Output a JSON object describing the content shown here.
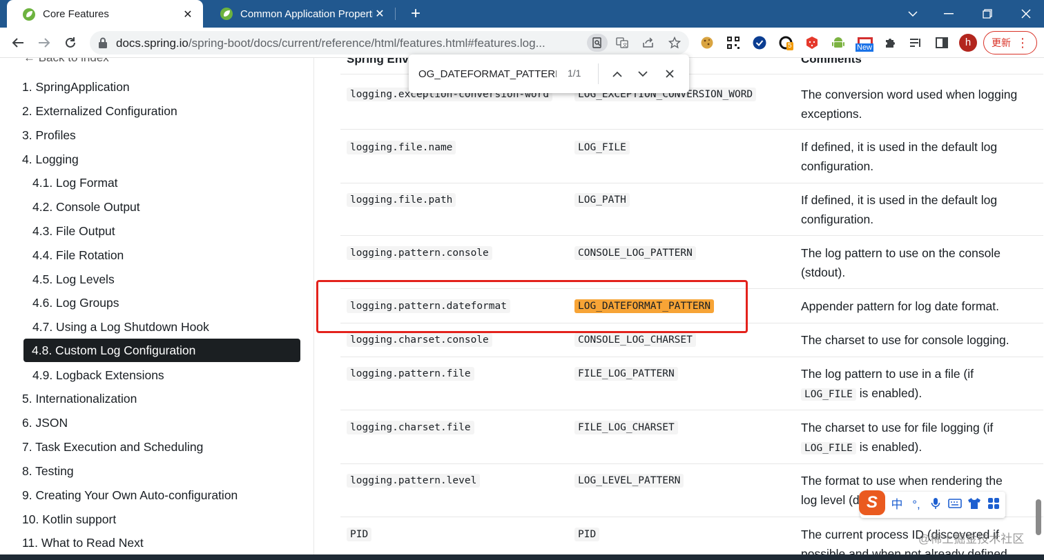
{
  "tabs": [
    {
      "title": "Core Features",
      "active": true
    },
    {
      "title": "Common Application Properties",
      "active": false
    }
  ],
  "address": {
    "host": "docs.spring.io",
    "path": "/spring-boot/docs/current/reference/html/features.html#features.log..."
  },
  "toolbar": {
    "profile_initial": "h",
    "update_label": "更新",
    "new_badge": "New",
    "ext_badge": "5"
  },
  "find": {
    "query": "OG_DATEFORMAT_PATTERN",
    "count": "1/1"
  },
  "sidebar": {
    "back": "← Back to index",
    "items": [
      {
        "label": "1. SpringApplication"
      },
      {
        "label": "2. Externalized Configuration"
      },
      {
        "label": "3. Profiles"
      },
      {
        "label": "4. Logging"
      },
      {
        "label": "4.1. Log Format"
      },
      {
        "label": "4.2. Console Output"
      },
      {
        "label": "4.3. File Output"
      },
      {
        "label": "4.4. File Rotation"
      },
      {
        "label": "4.5. Log Levels"
      },
      {
        "label": "4.6. Log Groups"
      },
      {
        "label": "4.7. Using a Log Shutdown Hook"
      },
      {
        "label": "4.8. Custom Log Configuration"
      },
      {
        "label": "4.9. Logback Extensions"
      },
      {
        "label": "5. Internationalization"
      },
      {
        "label": "6. JSON"
      },
      {
        "label": "7. Task Execution and Scheduling"
      },
      {
        "label": "8. Testing"
      },
      {
        "label": "9. Creating Your Own Auto-configuration"
      },
      {
        "label": "10. Kotlin support"
      },
      {
        "label": "11. What to Read Next"
      }
    ]
  },
  "table": {
    "headers": [
      "Spring Env",
      "Comments"
    ],
    "rows": [
      {
        "prop": "logging.exception-conversion-word",
        "sys": "LOG_EXCEPTION_CONVERSION_WORD",
        "desc": "The conversion word used when logging exceptions."
      },
      {
        "prop": "logging.file.name",
        "sys": "LOG_FILE",
        "desc": "If defined, it is used in the default log configuration."
      },
      {
        "prop": "logging.file.path",
        "sys": "LOG_PATH",
        "desc": "If defined, it is used in the default log configuration."
      },
      {
        "prop": "logging.pattern.console",
        "sys": "CONSOLE_LOG_PATTERN",
        "desc": "The log pattern to use on the console (stdout)."
      },
      {
        "prop": "logging.pattern.dateformat",
        "sys": "LOG_DATEFORMAT_PATTERN",
        "desc": "Appender pattern for log date format."
      },
      {
        "prop": "logging.charset.console",
        "sys": "CONSOLE_LOG_CHARSET",
        "desc": "The charset to use for console logging."
      },
      {
        "prop": "logging.pattern.file",
        "sys": "FILE_LOG_PATTERN",
        "desc_pre": "The log pattern to use in a file (if",
        "desc_code": "LOG_FILE",
        "desc_post": "is enabled)."
      },
      {
        "prop": "logging.charset.file",
        "sys": "FILE_LOG_CHARSET",
        "desc_pre": "The charset to use for file logging (if",
        "desc_code": "LOG_FILE",
        "desc_post": "is enabled)."
      },
      {
        "prop": "logging.pattern.level",
        "sys": "LOG_LEVEL_PATTERN",
        "desc": "The format to use when rendering the log level (d"
      },
      {
        "prop": "PID",
        "sys": "PID",
        "desc": "The current process ID (discovered if possible and when not already defined"
      }
    ]
  },
  "ime": {
    "logo": "S",
    "lang": "中",
    "punct": "°,"
  },
  "watermark": "@稀土掘金技术社区",
  "colors": {
    "tabstrip": "#21588f",
    "highlight": "#f7a436",
    "redbox": "#e3221c",
    "active_nav": "#1b1f22"
  }
}
